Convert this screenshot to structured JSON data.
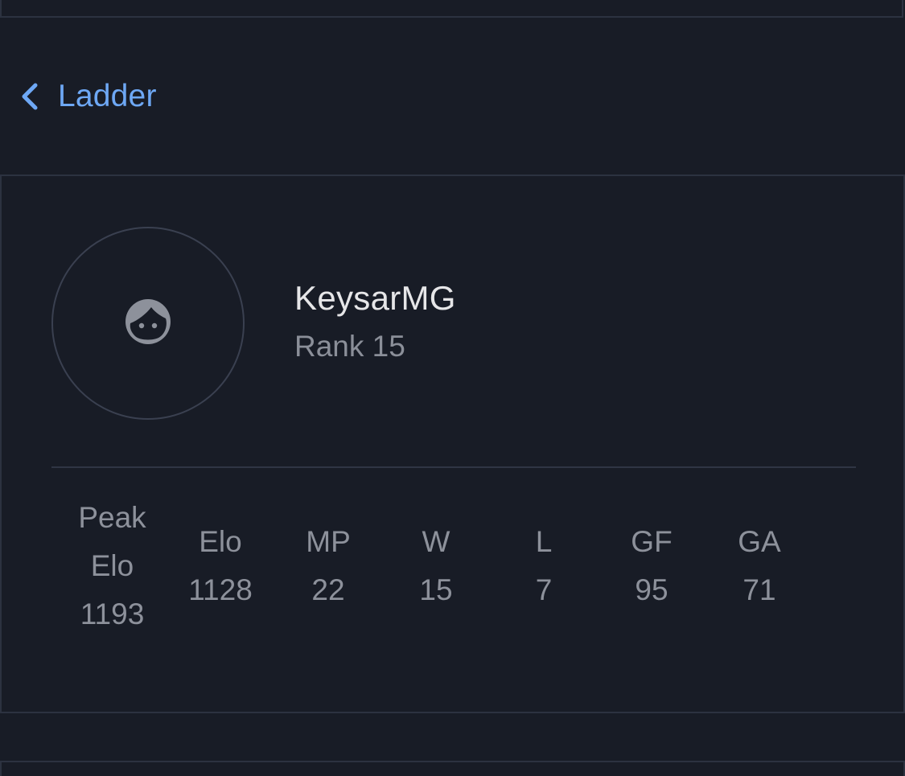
{
  "nav": {
    "back_label": "Ladder",
    "back_icon": "chevron-left-icon"
  },
  "colors": {
    "background": "#181c26",
    "link": "#6ea8f5",
    "border": "#2c3240",
    "primary_text": "#e6e6e8",
    "secondary_text": "#8d919b"
  },
  "profile": {
    "avatar_icon": "face-icon",
    "username": "KeysarMG",
    "rank": "Rank 15"
  },
  "stats": [
    {
      "label_line1": "Peak",
      "label_line2": "Elo",
      "value": "1193"
    },
    {
      "label": "Elo",
      "value": "1128"
    },
    {
      "label": "MP",
      "value": "22"
    },
    {
      "label": "W",
      "value": "15"
    },
    {
      "label": "L",
      "value": "7"
    },
    {
      "label": "GF",
      "value": "95"
    },
    {
      "label": "GA",
      "value": "71"
    }
  ]
}
